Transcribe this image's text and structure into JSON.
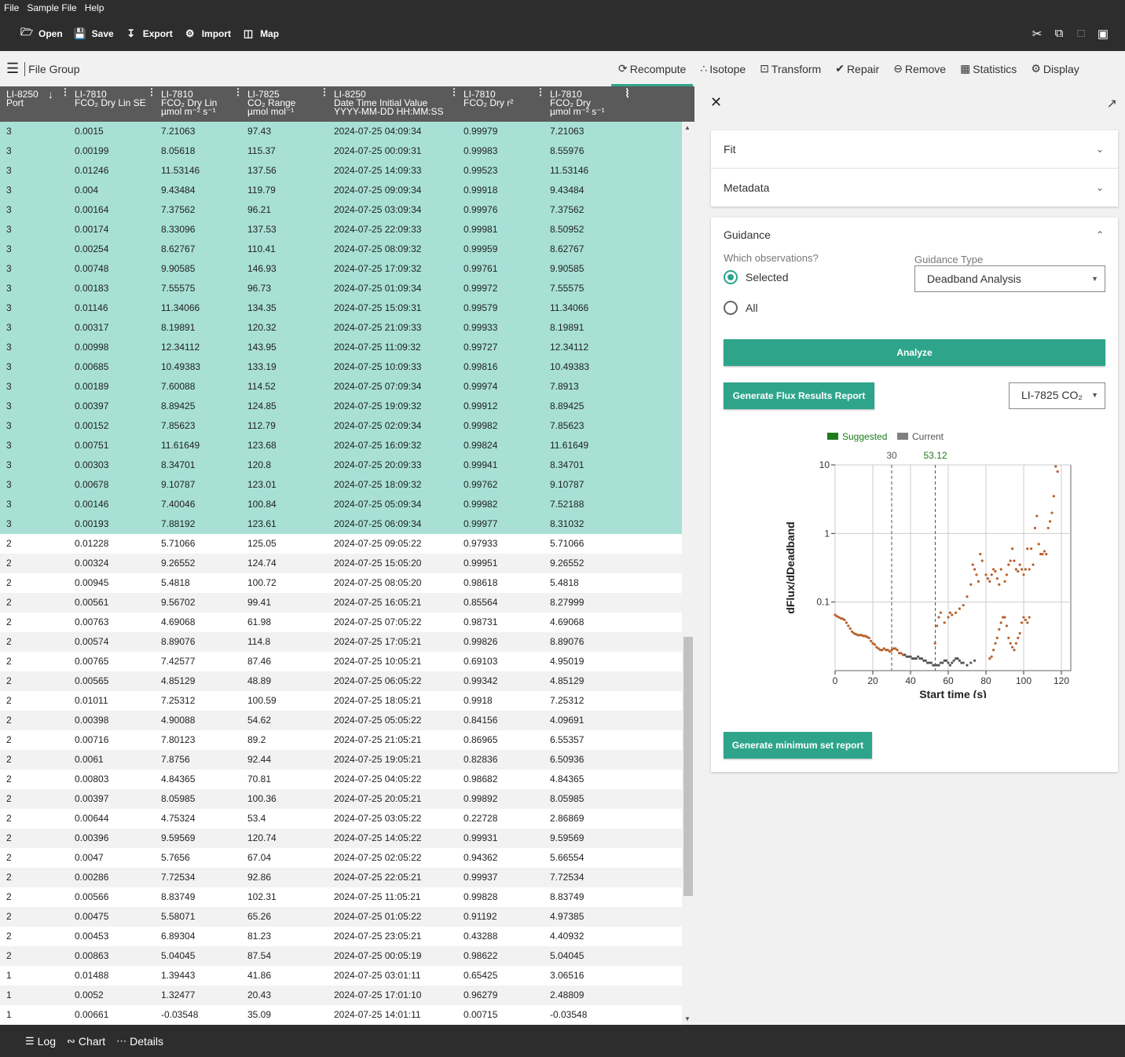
{
  "menu": [
    "File",
    "Sample File",
    "Help"
  ],
  "toolbar": {
    "open": "Open",
    "save": "Save",
    "export": "Export",
    "import": "Import",
    "map": "Map"
  },
  "subbar": {
    "file_group": "File Group"
  },
  "tabs": [
    {
      "label": "Recompute",
      "icon": "recompute-icon"
    },
    {
      "label": "Isotope",
      "icon": "isotope-icon"
    },
    {
      "label": "Transform",
      "icon": "transform-icon"
    },
    {
      "label": "Repair",
      "icon": "repair-icon"
    },
    {
      "label": "Remove",
      "icon": "remove-icon"
    },
    {
      "label": "Statistics",
      "icon": "statistics-icon"
    },
    {
      "label": "Display",
      "icon": "display-icon"
    }
  ],
  "table": {
    "headers": [
      {
        "l1": "LI-8250",
        "l2": "Port",
        "l3": ""
      },
      {
        "l1": "LI-7810",
        "l2": "FCO₂ Dry Lin SE",
        "l3": ""
      },
      {
        "l1": "LI-7810",
        "l2": "FCO₂ Dry Lin",
        "l3": "µmol m⁻² s⁻¹"
      },
      {
        "l1": "LI-7825",
        "l2": "CO₂ Range",
        "l3": "µmol mol⁻¹"
      },
      {
        "l1": "LI-8250",
        "l2": "Date Time Initial Value",
        "l3": "YYYY-MM-DD HH:MM:SS"
      },
      {
        "l1": "LI-7810",
        "l2": "FCO₂ Dry r²",
        "l3": ""
      },
      {
        "l1": "LI-7810",
        "l2": "FCO₂ Dry",
        "l3": "µmol m⁻² s⁻¹"
      }
    ],
    "selected_count": 21,
    "rows": [
      [
        "3",
        "0.0015",
        "7.21063",
        "97.43",
        "2024-07-25 04:09:34",
        "0.99979",
        "7.21063"
      ],
      [
        "3",
        "0.00199",
        "8.05618",
        "115.37",
        "2024-07-25 00:09:31",
        "0.99983",
        "8.55976"
      ],
      [
        "3",
        "0.01246",
        "11.53146",
        "137.56",
        "2024-07-25 14:09:33",
        "0.99523",
        "11.53146"
      ],
      [
        "3",
        "0.004",
        "9.43484",
        "119.79",
        "2024-07-25 09:09:34",
        "0.99918",
        "9.43484"
      ],
      [
        "3",
        "0.00164",
        "7.37562",
        "96.21",
        "2024-07-25 03:09:34",
        "0.99976",
        "7.37562"
      ],
      [
        "3",
        "0.00174",
        "8.33096",
        "137.53",
        "2024-07-25 22:09:33",
        "0.99981",
        "8.50952"
      ],
      [
        "3",
        "0.00254",
        "8.62767",
        "110.41",
        "2024-07-25 08:09:32",
        "0.99959",
        "8.62767"
      ],
      [
        "3",
        "0.00748",
        "9.90585",
        "146.93",
        "2024-07-25 17:09:32",
        "0.99761",
        "9.90585"
      ],
      [
        "3",
        "0.00183",
        "7.55575",
        "96.73",
        "2024-07-25 01:09:34",
        "0.99972",
        "7.55575"
      ],
      [
        "3",
        "0.01146",
        "11.34066",
        "134.35",
        "2024-07-25 15:09:31",
        "0.99579",
        "11.34066"
      ],
      [
        "3",
        "0.00317",
        "8.19891",
        "120.32",
        "2024-07-25 21:09:33",
        "0.99933",
        "8.19891"
      ],
      [
        "3",
        "0.00998",
        "12.34112",
        "143.95",
        "2024-07-25 11:09:32",
        "0.99727",
        "12.34112"
      ],
      [
        "3",
        "0.00685",
        "10.49383",
        "133.19",
        "2024-07-25 10:09:33",
        "0.99816",
        "10.49383"
      ],
      [
        "3",
        "0.00189",
        "7.60088",
        "114.52",
        "2024-07-25 07:09:34",
        "0.99974",
        "7.8913"
      ],
      [
        "3",
        "0.00397",
        "8.89425",
        "124.85",
        "2024-07-25 19:09:32",
        "0.99912",
        "8.89425"
      ],
      [
        "3",
        "0.00152",
        "7.85623",
        "112.79",
        "2024-07-25 02:09:34",
        "0.99982",
        "7.85623"
      ],
      [
        "3",
        "0.00751",
        "11.61649",
        "123.68",
        "2024-07-25 16:09:32",
        "0.99824",
        "11.61649"
      ],
      [
        "3",
        "0.00303",
        "8.34701",
        "120.8",
        "2024-07-25 20:09:33",
        "0.99941",
        "8.34701"
      ],
      [
        "3",
        "0.00678",
        "9.10787",
        "123.01",
        "2024-07-25 18:09:32",
        "0.99762",
        "9.10787"
      ],
      [
        "3",
        "0.00146",
        "7.40046",
        "100.84",
        "2024-07-25 05:09:34",
        "0.99982",
        "7.52188"
      ],
      [
        "3",
        "0.00193",
        "7.88192",
        "123.61",
        "2024-07-25 06:09:34",
        "0.99977",
        "8.31032"
      ],
      [
        "2",
        "0.01228",
        "5.71066",
        "125.05",
        "2024-07-25 09:05:22",
        "0.97933",
        "5.71066"
      ],
      [
        "2",
        "0.00324",
        "9.26552",
        "124.74",
        "2024-07-25 15:05:20",
        "0.99951",
        "9.26552"
      ],
      [
        "2",
        "0.00945",
        "5.4818",
        "100.72",
        "2024-07-25 08:05:20",
        "0.98618",
        "5.4818"
      ],
      [
        "2",
        "0.00561",
        "9.56702",
        "99.41",
        "2024-07-25 16:05:21",
        "0.85564",
        "8.27999"
      ],
      [
        "2",
        "0.00763",
        "4.69068",
        "61.98",
        "2024-07-25 07:05:22",
        "0.98731",
        "4.69068"
      ],
      [
        "2",
        "0.00574",
        "8.89076",
        "114.8",
        "2024-07-25 17:05:21",
        "0.99826",
        "8.89076"
      ],
      [
        "2",
        "0.00765",
        "7.42577",
        "87.46",
        "2024-07-25 10:05:21",
        "0.69103",
        "4.95019"
      ],
      [
        "2",
        "0.00565",
        "4.85129",
        "48.89",
        "2024-07-25 06:05:22",
        "0.99342",
        "4.85129"
      ],
      [
        "2",
        "0.01011",
        "7.25312",
        "100.59",
        "2024-07-25 18:05:21",
        "0.9918",
        "7.25312"
      ],
      [
        "2",
        "0.00398",
        "4.90088",
        "54.62",
        "2024-07-25 05:05:22",
        "0.84156",
        "4.09691"
      ],
      [
        "2",
        "0.00716",
        "7.80123",
        "89.2",
        "2024-07-25 21:05:21",
        "0.86965",
        "6.55357"
      ],
      [
        "2",
        "0.0061",
        "7.8756",
        "92.44",
        "2024-07-25 19:05:21",
        "0.82836",
        "6.50936"
      ],
      [
        "2",
        "0.00803",
        "4.84365",
        "70.81",
        "2024-07-25 04:05:22",
        "0.98682",
        "4.84365"
      ],
      [
        "2",
        "0.00397",
        "8.05985",
        "100.36",
        "2024-07-25 20:05:21",
        "0.99892",
        "8.05985"
      ],
      [
        "2",
        "0.00644",
        "4.75324",
        "53.4",
        "2024-07-25 03:05:22",
        "0.22728",
        "2.86869"
      ],
      [
        "2",
        "0.00396",
        "9.59569",
        "120.74",
        "2024-07-25 14:05:22",
        "0.99931",
        "9.59569"
      ],
      [
        "2",
        "0.0047",
        "5.7656",
        "67.04",
        "2024-07-25 02:05:22",
        "0.94362",
        "5.66554"
      ],
      [
        "2",
        "0.00286",
        "7.72534",
        "92.86",
        "2024-07-25 22:05:21",
        "0.99937",
        "7.72534"
      ],
      [
        "2",
        "0.00566",
        "8.83749",
        "102.31",
        "2024-07-25 11:05:21",
        "0.99828",
        "8.83749"
      ],
      [
        "2",
        "0.00475",
        "5.58071",
        "65.26",
        "2024-07-25 01:05:22",
        "0.91192",
        "4.97385"
      ],
      [
        "2",
        "0.00453",
        "6.89304",
        "81.23",
        "2024-07-25 23:05:21",
        "0.43288",
        "4.40932"
      ],
      [
        "2",
        "0.00863",
        "5.04045",
        "87.54",
        "2024-07-25 00:05:19",
        "0.98622",
        "5.04045"
      ],
      [
        "1",
        "0.01488",
        "1.39443",
        "41.86",
        "2024-07-25 03:01:11",
        "0.65425",
        "3.06516"
      ],
      [
        "1",
        "0.0052",
        "1.32477",
        "20.43",
        "2024-07-25 17:01:10",
        "0.96279",
        "2.48809"
      ],
      [
        "1",
        "0.00661",
        "-0.03548",
        "35.09",
        "2024-07-25 14:01:11",
        "0.00715",
        "-0.03548"
      ]
    ]
  },
  "panel": {
    "fit_label": "Fit",
    "metadata_label": "Metadata",
    "guidance_label": "Guidance",
    "which_obs_label": "Which observations?",
    "radio_selected": "Selected",
    "radio_all": "All",
    "guidance_type_label": "Guidance Type",
    "guidance_type_value": "Deadband Analysis",
    "analyze_label": "Analyze",
    "flux_report_label": "Generate Flux Results Report",
    "instrument_select": "LI-7825 CO₂",
    "min_set_label": "Generate minimum set report"
  },
  "chart_data": {
    "type": "scatter",
    "xlabel": "Start time (s)",
    "ylabel": "dFlux/dDeadband",
    "xlim": [
      0,
      125
    ],
    "ylim": [
      0.01,
      10
    ],
    "y_scale": "log",
    "x_ticks": [
      0,
      20,
      40,
      60,
      80,
      100,
      120
    ],
    "y_ticks": [
      {
        "v": 10,
        "label": "10"
      },
      {
        "v": 1,
        "label": "1"
      },
      {
        "v": 0.1,
        "label": "0.1"
      }
    ],
    "legend": [
      {
        "name": "Suggested",
        "color": "#1e7b1e"
      },
      {
        "name": "Current",
        "color": "#808080"
      }
    ],
    "markers": [
      {
        "x": 30,
        "label": "30",
        "color": "#555555"
      },
      {
        "x": 53.12,
        "label": "53.12",
        "color": "#1e7b1e"
      }
    ],
    "grid": true,
    "series": [
      {
        "color": "#b8602c",
        "x": [
          0,
          1,
          2,
          3,
          4,
          5,
          6,
          7,
          8,
          9,
          10,
          11,
          12,
          13,
          14,
          15,
          16,
          17,
          18,
          19,
          20,
          21,
          22,
          23,
          24,
          25,
          26,
          27,
          28,
          29,
          30,
          31,
          32,
          33,
          34,
          35,
          36
        ],
        "y": [
          0.065,
          0.062,
          0.06,
          0.058,
          0.057,
          0.055,
          0.05,
          0.045,
          0.041,
          0.037,
          0.035,
          0.034,
          0.033,
          0.033,
          0.033,
          0.032,
          0.032,
          0.031,
          0.03,
          0.027,
          0.025,
          0.024,
          0.022,
          0.021,
          0.02,
          0.02,
          0.021,
          0.02,
          0.02,
          0.019,
          0.02,
          0.021,
          0.021,
          0.02,
          0.018,
          0.018,
          0.017
        ]
      },
      {
        "color": "#555555",
        "x": [
          37,
          38,
          39,
          40,
          41,
          42,
          43,
          44,
          45,
          46,
          47,
          48,
          49,
          50,
          51,
          52,
          53,
          54,
          55,
          56,
          57,
          58,
          59,
          60,
          61,
          62,
          63,
          64,
          65,
          66,
          67,
          68,
          70,
          72,
          74
        ],
        "y": [
          0.017,
          0.016,
          0.016,
          0.016,
          0.015,
          0.015,
          0.015,
          0.016,
          0.015,
          0.015,
          0.014,
          0.014,
          0.013,
          0.013,
          0.013,
          0.012,
          0.012,
          0.012,
          0.012,
          0.013,
          0.013,
          0.014,
          0.014,
          0.013,
          0.012,
          0.013,
          0.014,
          0.015,
          0.015,
          0.014,
          0.013,
          0.013,
          0.012,
          0.013,
          0.014
        ]
      },
      {
        "color": "#b8602c",
        "x": [
          53,
          54,
          55,
          56,
          58,
          60,
          61,
          62,
          64,
          66,
          68,
          70,
          72,
          73,
          74,
          75,
          76,
          77,
          78,
          80,
          81,
          82,
          83,
          84,
          85,
          86,
          87,
          88,
          90,
          91,
          92,
          93,
          94,
          95,
          96,
          97,
          98,
          99,
          100,
          101,
          102,
          103,
          104,
          105,
          106,
          107,
          108,
          109,
          110,
          111,
          112,
          113,
          114,
          115,
          116,
          117,
          118
        ],
        "y": [
          0.025,
          0.045,
          0.06,
          0.07,
          0.05,
          0.06,
          0.07,
          0.065,
          0.07,
          0.08,
          0.09,
          0.12,
          0.18,
          0.35,
          0.3,
          0.25,
          0.2,
          0.5,
          0.4,
          0.25,
          0.22,
          0.2,
          0.25,
          0.3,
          0.28,
          0.22,
          0.18,
          0.3,
          0.2,
          0.25,
          0.35,
          0.4,
          0.6,
          0.4,
          0.3,
          0.28,
          0.35,
          0.3,
          0.25,
          0.3,
          0.6,
          0.3,
          0.6,
          0.35,
          1.2,
          1.8,
          0.7,
          0.5,
          0.5,
          0.55,
          0.5,
          1.2,
          1.5,
          2.0,
          3.5,
          9.5,
          8.0
        ]
      },
      {
        "color": "#b8602c",
        "x": [
          82,
          83,
          84,
          85,
          86,
          87,
          88,
          89,
          90,
          91,
          92,
          93,
          94,
          95,
          96,
          97,
          98,
          99,
          100,
          101,
          102,
          103
        ],
        "y": [
          0.015,
          0.016,
          0.02,
          0.025,
          0.03,
          0.04,
          0.05,
          0.06,
          0.06,
          0.045,
          0.03,
          0.025,
          0.022,
          0.02,
          0.025,
          0.03,
          0.035,
          0.05,
          0.06,
          0.055,
          0.05,
          0.06
        ]
      }
    ]
  },
  "bottombar": {
    "log": "Log",
    "chart": "Chart",
    "details": "Details"
  }
}
